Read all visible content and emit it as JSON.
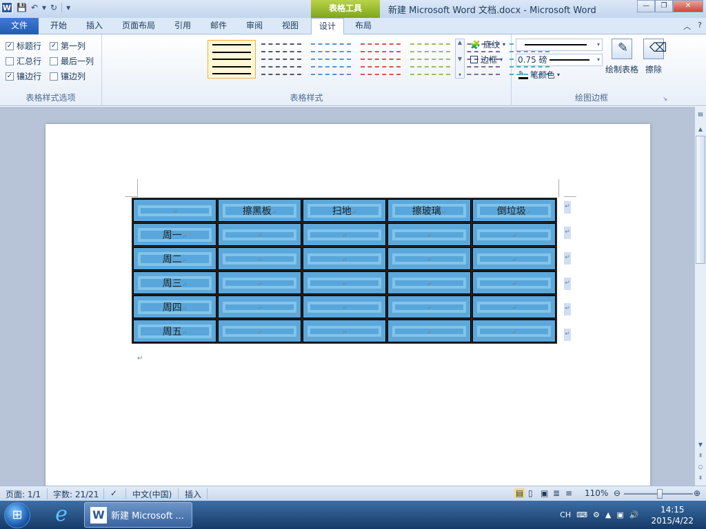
{
  "title_bar": {
    "app_icon": "W",
    "qat": {
      "save": "save-icon",
      "undo": "↶",
      "undo_dd": "▾",
      "redo": "↻",
      "customize": "▾"
    },
    "context_tab_group": "表格工具",
    "document_title": "新建 Microsoft Word 文档.docx - Microsoft Word",
    "window_buttons": {
      "minimize": "—",
      "restore": "❐",
      "close": "✕"
    }
  },
  "tabs": {
    "file": "文件",
    "items": [
      "开始",
      "插入",
      "页面布局",
      "引用",
      "邮件",
      "审阅",
      "视图",
      "设计",
      "布局"
    ],
    "active": "设计",
    "collapse": "︿",
    "help": "?"
  },
  "ribbon": {
    "table_style_options": {
      "label": "表格样式选项",
      "options": [
        {
          "label": "标题行",
          "checked": true
        },
        {
          "label": "第一列",
          "checked": true
        },
        {
          "label": "汇总行",
          "checked": false
        },
        {
          "label": "最后一列",
          "checked": false
        },
        {
          "label": "镶边行",
          "checked": true
        },
        {
          "label": "镶边列",
          "checked": false
        }
      ]
    },
    "table_styles": {
      "label": "表格样式",
      "thumb_colors": [
        "#000000",
        "#555555",
        "#5b8fd1",
        "#d9534f",
        "#9bbb59",
        "#8064a2",
        "#4bacc6"
      ],
      "shading": "底纹",
      "borders": "边框"
    },
    "draw_borders": {
      "label": "绘图边框",
      "line_weight": "0.75 磅",
      "pen_color": "笔颜色",
      "draw_table": "绘制表格",
      "eraser": "擦除"
    }
  },
  "document": {
    "table": {
      "header": [
        "",
        "擦黑板",
        "扫地",
        "擦玻璃",
        "倒垃圾"
      ],
      "rows": [
        [
          "周一",
          "",
          "",
          "",
          ""
        ],
        [
          "周二",
          "",
          "",
          "",
          ""
        ],
        [
          "周三",
          "",
          "",
          "",
          ""
        ],
        [
          "周四",
          "",
          "",
          "",
          ""
        ],
        [
          "周五",
          "",
          "",
          "",
          ""
        ]
      ],
      "cell_color": "#5ca8dc",
      "cell_mark": "↵"
    },
    "paragraph_mark": "↵"
  },
  "status_bar": {
    "page": "页面: 1/1",
    "word_count": "字数: 21/21",
    "language": "中文(中国)",
    "mode": "插入",
    "zoom": "110%",
    "zoom_level_percent": 110
  },
  "taskbar": {
    "word_item": "新建 Microsoft ...",
    "ime": "CH",
    "time": "14:15",
    "date": "2015/4/22"
  }
}
